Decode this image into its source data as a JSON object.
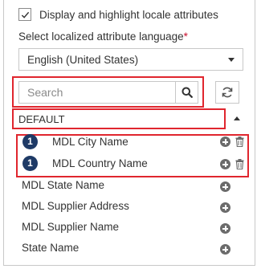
{
  "options": {
    "display_highlight_label": "Display and highlight locale attributes",
    "display_highlight_checked": true
  },
  "language": {
    "label": "Select localized attribute language",
    "required_mark": "*",
    "selected": "English (United States)"
  },
  "search": {
    "placeholder": "Search"
  },
  "group": {
    "name": "DEFAULT"
  },
  "selected_attributes": [
    {
      "badge": "1",
      "name": "MDL City Name"
    },
    {
      "badge": "1",
      "name": "MDL Country Name"
    }
  ],
  "available_attributes": [
    {
      "name": "MDL State Name"
    },
    {
      "name": "MDL Supplier Address"
    },
    {
      "name": "MDL Supplier Name"
    },
    {
      "name": "State Name"
    }
  ],
  "colors": {
    "highlight_border": "#e0262e",
    "badge": "#1e3a66",
    "required": "#c8102e",
    "icon_gray": "#6b6b6b"
  },
  "icons": [
    "checkmark-icon",
    "chevron-down-icon",
    "search-icon",
    "refresh-icon",
    "chevron-up-icon",
    "add-circle-icon",
    "trash-icon"
  ]
}
